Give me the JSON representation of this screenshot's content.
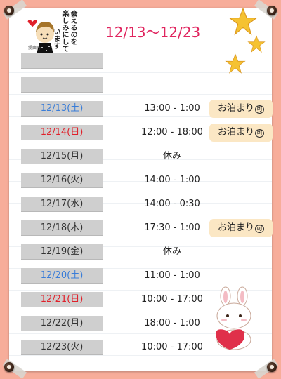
{
  "header": {
    "title": "12/13〜12/23",
    "note_lines": [
      "会えるのを",
      "楽しみにして",
      "います"
    ],
    "signature": "愛由乃"
  },
  "colors": {
    "background": "#f7ad9a",
    "title": "#e0245e",
    "weekday": "#333333",
    "saturday": "#3a7dd8",
    "sunday": "#e0202a",
    "stay_badge": "#fbe7c4"
  },
  "schedule": [
    {
      "date": "",
      "time": "",
      "stay": ""
    },
    {
      "date": "",
      "time": "",
      "stay": ""
    },
    {
      "date": "12/13(土)",
      "time": "13:00 - 1:00",
      "stay": "お泊まり",
      "stay_mark": "可",
      "day": "sat"
    },
    {
      "date": "12/14(日)",
      "time": "12:00 - 18:00",
      "stay": "お泊まり",
      "stay_mark": "可",
      "day": "sun"
    },
    {
      "date": "12/15(月)",
      "time": "休み",
      "stay": "",
      "day": "weekday"
    },
    {
      "date": "12/16(火)",
      "time": "14:00 - 1:00",
      "stay": "",
      "day": "weekday"
    },
    {
      "date": "12/17(水)",
      "time": "14:00 - 0:30",
      "stay": "",
      "day": "weekday"
    },
    {
      "date": "12/18(木)",
      "time": "17:30 - 1:00",
      "stay": "お泊まり",
      "stay_mark": "可",
      "day": "weekday"
    },
    {
      "date": "12/19(金)",
      "time": "休み",
      "stay": "",
      "day": "weekday"
    },
    {
      "date": "12/20(土)",
      "time": "11:00 - 1:00",
      "stay": "",
      "day": "sat"
    },
    {
      "date": "12/21(日)",
      "time": "10:00 - 17:00",
      "stay": "",
      "day": "sun"
    },
    {
      "date": "12/22(月)",
      "time": "18:00 - 1:00",
      "stay": "",
      "day": "weekday"
    },
    {
      "date": "12/23(火)",
      "time": "10:00 - 17:00",
      "stay": "",
      "day": "weekday"
    }
  ],
  "icons": [
    "pushpin-icon",
    "star-icon",
    "girl-illustration",
    "bunny-heart-illustration",
    "heart-icon"
  ]
}
